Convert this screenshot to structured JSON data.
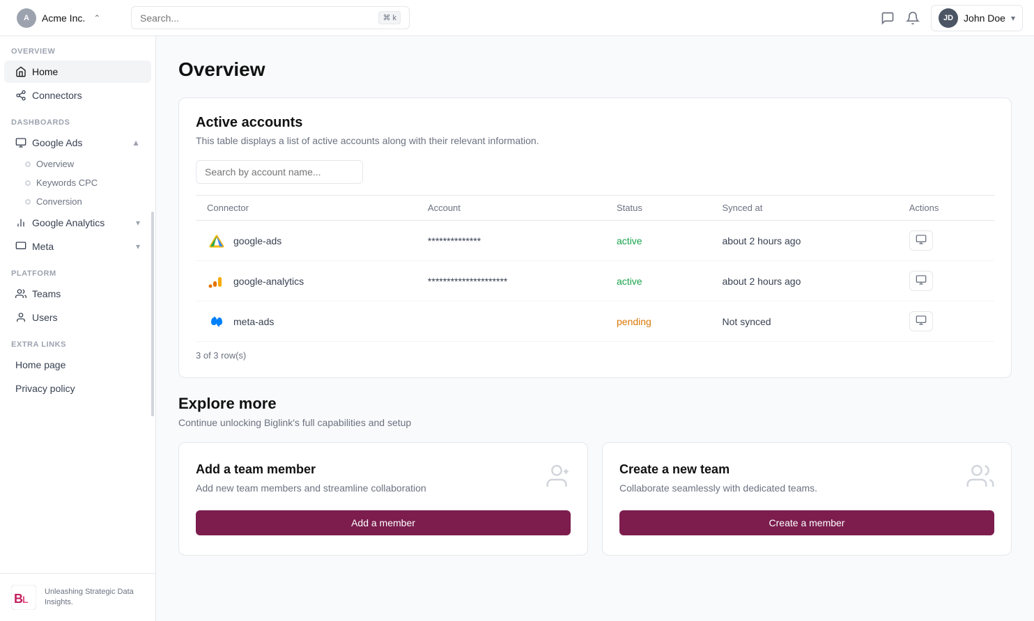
{
  "topbar": {
    "org_name": "Acme Inc.",
    "search_placeholder": "Search...",
    "search_kbd": "⌘ k",
    "user_initials": "JD",
    "user_name": "John Doe"
  },
  "sidebar": {
    "overview_label": "OVERVIEW",
    "home_label": "Home",
    "connectors_label": "Connectors",
    "dashboards_label": "DASHBOARDS",
    "google_ads_label": "Google Ads",
    "overview_sub_label": "Overview",
    "keywords_cpc_sub_label": "Keywords CPC",
    "conversion_sub_label": "Conversion",
    "google_analytics_label": "Google Analytics",
    "meta_label": "Meta",
    "platform_label": "PLATFORM",
    "teams_label": "Teams",
    "users_label": "Users",
    "extra_links_label": "EXTRA LINKS",
    "home_page_label": "Home page",
    "privacy_policy_label": "Privacy policy",
    "footer_tagline": "Unleashing Strategic Data Insights."
  },
  "main": {
    "page_title": "Overview",
    "active_accounts": {
      "title": "Active accounts",
      "description": "This table displays a list of active accounts along with their relevant information.",
      "search_placeholder": "Search by account name...",
      "columns": [
        "Connector",
        "Account",
        "Status",
        "Synced at",
        "Actions"
      ],
      "rows": [
        {
          "connector": "google-ads",
          "account": "**************",
          "status": "active",
          "synced_at": "about 2 hours ago"
        },
        {
          "connector": "google-analytics",
          "account": "*********************",
          "status": "active",
          "synced_at": "about 2 hours ago"
        },
        {
          "connector": "meta-ads",
          "account": "",
          "status": "pending",
          "synced_at": "Not synced"
        }
      ],
      "rows_info": "3 of 3 row(s)"
    },
    "explore_more": {
      "title": "Explore more",
      "description": "Continue unlocking Biglink's full capabilities and setup",
      "cards": [
        {
          "title": "Add a team member",
          "description": "Add new team members and streamline collaboration",
          "button_label": "Add a member"
        },
        {
          "title": "Create a new team",
          "description": "Collaborate seamlessly with dedicated teams.",
          "button_label": "Create a member"
        }
      ]
    }
  }
}
